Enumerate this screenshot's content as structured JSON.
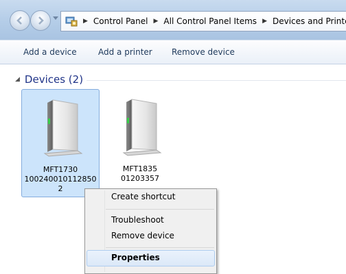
{
  "address_bar": {
    "breadcrumbs": [
      "Control Panel",
      "All Control Panel Items",
      "Devices and Printe"
    ]
  },
  "toolbar": {
    "add_device": "Add a device",
    "add_printer": "Add a printer",
    "remove_device": "Remove device"
  },
  "group": {
    "title": "Devices (2)"
  },
  "devices": [
    {
      "label_lines": [
        "MFT1730",
        "100240010112850",
        "2"
      ],
      "selected": true
    },
    {
      "label_lines": [
        "MFT1835",
        "01203357"
      ],
      "selected": false
    }
  ],
  "context_menu": {
    "create_shortcut": "Create shortcut",
    "troubleshoot": "Troubleshoot",
    "remove_device": "Remove device",
    "properties": "Properties"
  },
  "icons": {
    "back": "back-arrow-icon",
    "forward": "forward-arrow-icon",
    "history": "chevron-down-icon",
    "control_panel": "control-panel-icon",
    "breadcrumb_separator": "chevron-right-icon",
    "device": "device-tower-icon"
  },
  "colors": {
    "group_title": "#1e3287",
    "selection_fill": "#cce4fb",
    "selection_border": "#84acdd",
    "toolbar_text": "#1e395b"
  }
}
